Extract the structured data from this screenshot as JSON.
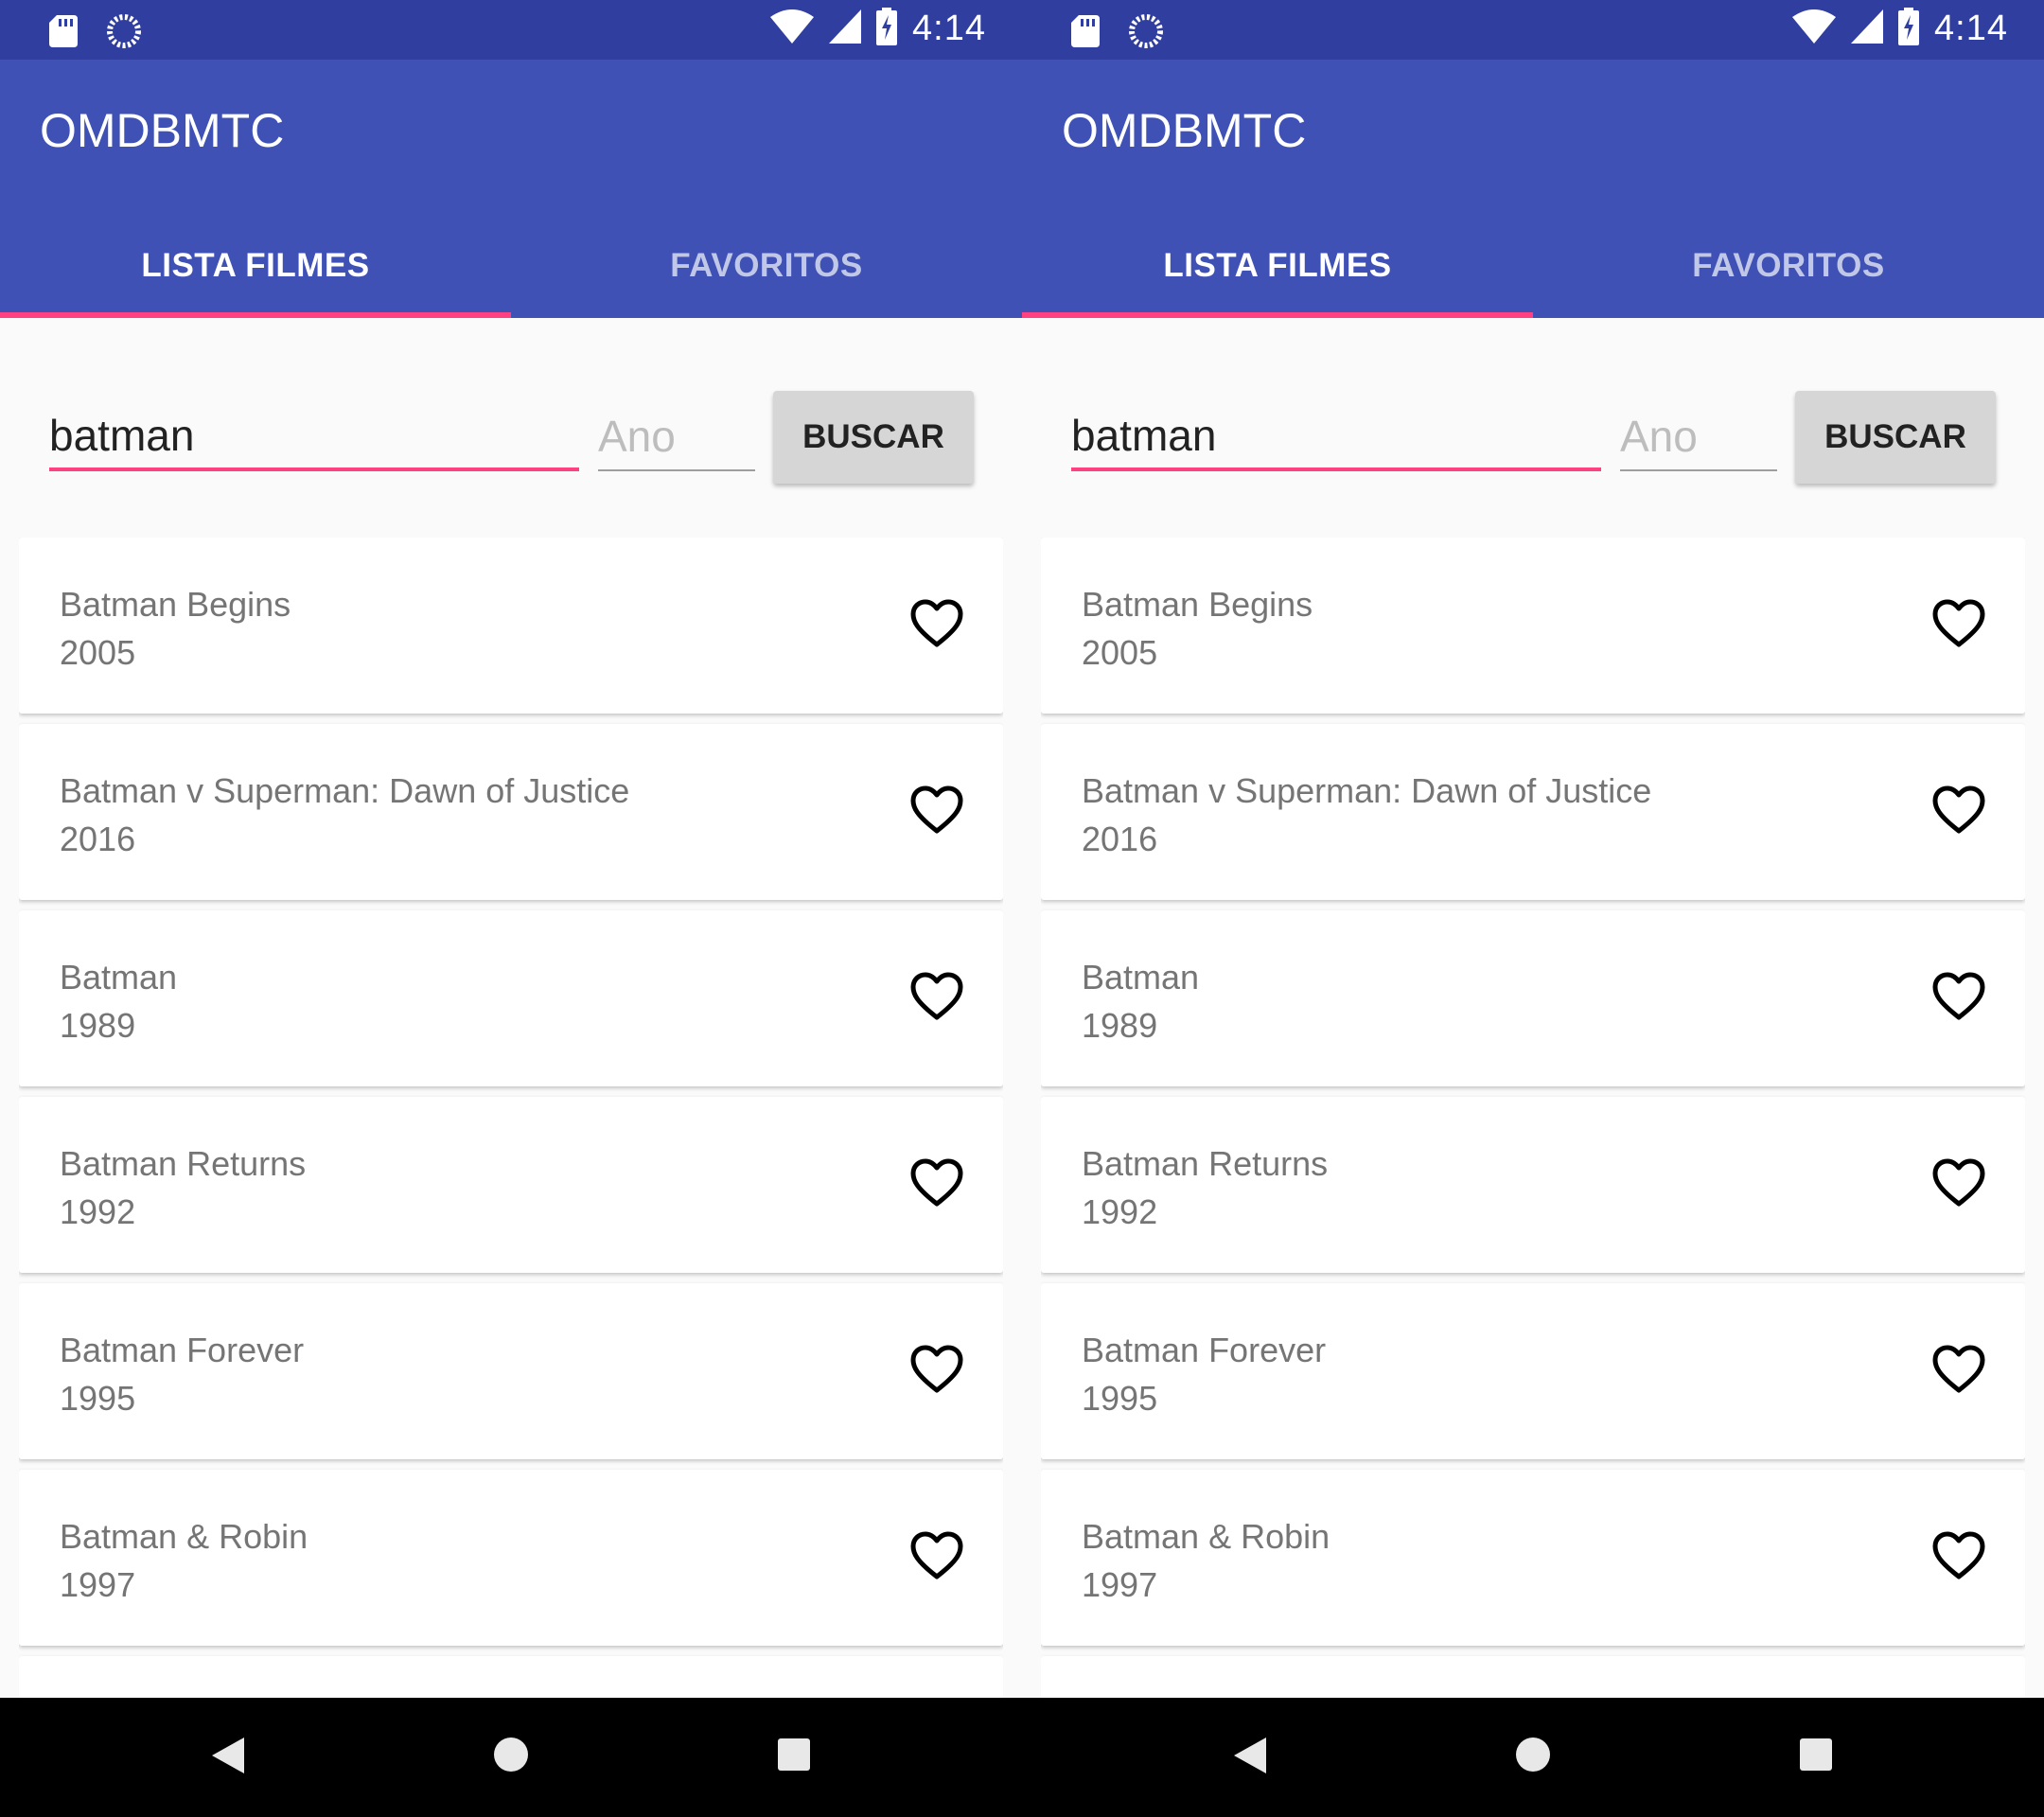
{
  "status_bar": {
    "time": "4:14",
    "icons": [
      "sd-card-icon",
      "sync-icon",
      "wifi-icon",
      "cell-signal-icon",
      "battery-charging-icon"
    ]
  },
  "app": {
    "title": "OMDBMTC",
    "primary_color": "#3f51b5",
    "status_color": "#303f9f",
    "accent_color": "#ff4081"
  },
  "tabs": [
    {
      "label": "LISTA FILMES",
      "active": true
    },
    {
      "label": "FAVORITOS",
      "active": false
    }
  ],
  "search": {
    "query_value": "batman",
    "year_placeholder": "Ano",
    "year_value": "",
    "button_label": "BUSCAR"
  },
  "movies": [
    {
      "title": "Batman Begins",
      "year": "2005"
    },
    {
      "title": "Batman v Superman: Dawn of Justice",
      "year": "2016"
    },
    {
      "title": "Batman",
      "year": "1989"
    },
    {
      "title": "Batman Returns",
      "year": "1992"
    },
    {
      "title": "Batman Forever",
      "year": "1995"
    },
    {
      "title": "Batman & Robin",
      "year": "1997"
    }
  ],
  "nav": [
    "back-icon",
    "home-icon",
    "recents-icon"
  ]
}
